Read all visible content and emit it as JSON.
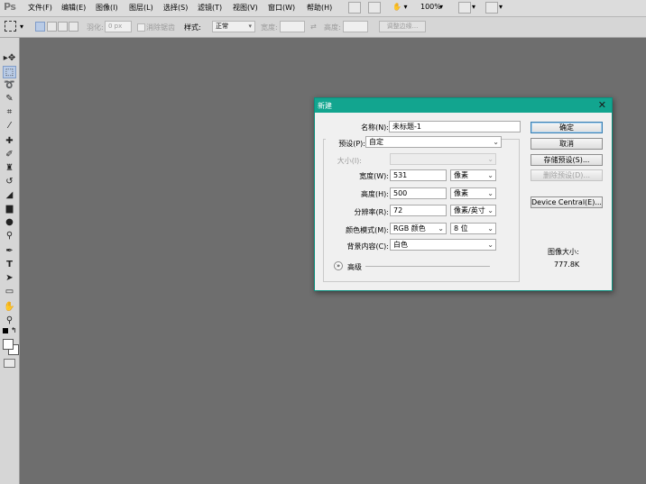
{
  "app": {
    "logo": "Ps"
  },
  "menu": {
    "items": [
      "文件(F)",
      "编辑(E)",
      "图像(I)",
      "图层(L)",
      "选择(S)",
      "滤镜(T)",
      "视图(V)",
      "窗口(W)",
      "帮助(H)"
    ],
    "zoom": "100%"
  },
  "options": {
    "feather_label": "羽化:",
    "feather_value": "0 px",
    "antialias_label": "消除锯齿",
    "style_label": "样式:",
    "style_value": "正常",
    "width_label": "宽度:",
    "height_label": "高度:",
    "refine_button": "调整边缘..."
  },
  "dialog": {
    "title": "新建",
    "name_label": "名称(N):",
    "name_value": "未标题-1",
    "preset_label": "预设(P):",
    "preset_value": "自定",
    "size_label": "大小(I):",
    "width_label": "宽度(W):",
    "width_value": "531",
    "width_unit": "像素",
    "height_label": "高度(H):",
    "height_value": "500",
    "height_unit": "像素",
    "resolution_label": "分辨率(R):",
    "resolution_value": "72",
    "resolution_unit": "像素/英寸",
    "color_mode_label": "颜色模式(M):",
    "color_mode_value": "RGB 颜色",
    "bit_depth_value": "8 位",
    "background_label": "背景内容(C):",
    "background_value": "白色",
    "advanced_label": "高级",
    "ok_button": "确定",
    "cancel_button": "取消",
    "save_preset_button": "存储预设(S)...",
    "delete_preset_button": "删除预设(D)...",
    "device_central_button": "Device Central(E)...",
    "image_size_label": "图像大小:",
    "image_size_value": "777.8K"
  },
  "colors": {
    "canvas_bg": "#6e6e6e",
    "title_bar": "#12a58f",
    "chrome": "#d6d6d6"
  }
}
